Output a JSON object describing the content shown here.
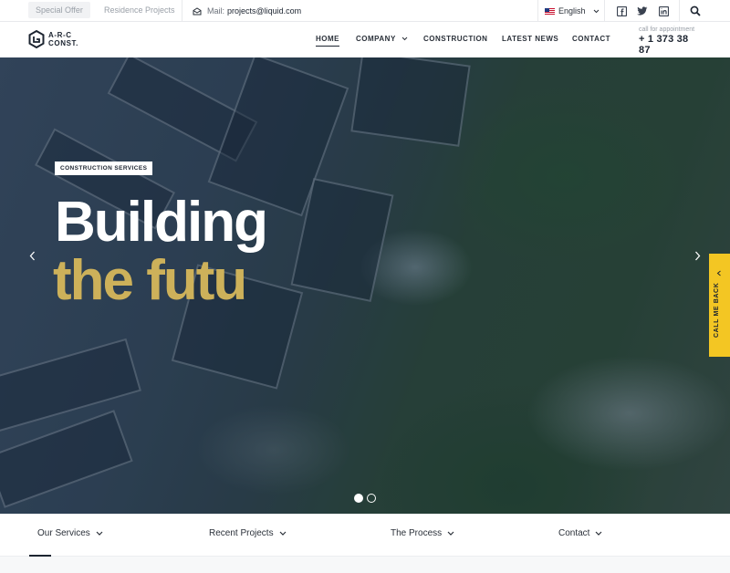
{
  "topbar": {
    "special_offer": "Special Offer",
    "residence_projects": "Residence Projects",
    "mail_label": "Mail:",
    "mail_address": "projects@liquid.com",
    "language": "English",
    "social_icons": [
      "facebook-icon",
      "twitter-icon",
      "linkedin-icon"
    ],
    "search_icon": "search-icon"
  },
  "header": {
    "logo_line1": "A-R-C",
    "logo_line2": "CONST.",
    "nav": [
      {
        "label": "HOME",
        "active": true,
        "dropdown": false
      },
      {
        "label": "COMPANY",
        "active": false,
        "dropdown": true
      },
      {
        "label": "CONSTRUCTION",
        "active": false,
        "dropdown": false
      },
      {
        "label": "LATEST NEWS",
        "active": false,
        "dropdown": false
      },
      {
        "label": "CONTACT",
        "active": false,
        "dropdown": false
      }
    ],
    "appointment_label": "call for appointment",
    "appointment_phone": "+ 1 373 38 87"
  },
  "hero": {
    "tag": "CONSTRUCTION SERVICES",
    "headline_line1": "Building",
    "headline_line2": "the futu",
    "headline_accent_color": "#cdb15a",
    "slides": 2,
    "active_slide": 1,
    "callback_label": "CALL ME BACK",
    "callback_color": "#f3c623"
  },
  "tabs": [
    {
      "label": "Our Services",
      "active": true
    },
    {
      "label": "Recent Projects",
      "active": false
    },
    {
      "label": "The Process",
      "active": false
    },
    {
      "label": "Contact",
      "active": false
    }
  ]
}
